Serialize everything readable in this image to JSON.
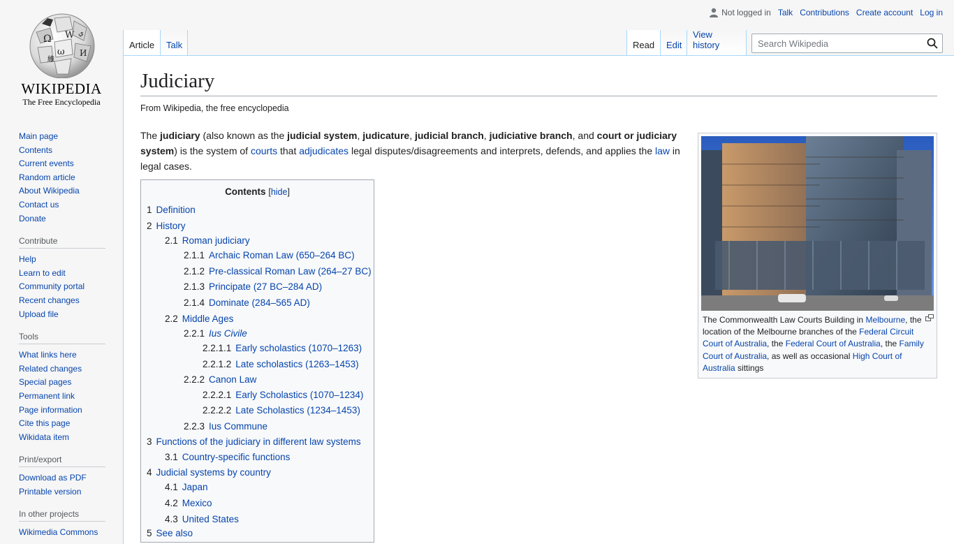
{
  "logo": {
    "wordmark": "WIKIPEDIA",
    "tagline": "The Free Encyclopedia"
  },
  "personal": {
    "not_logged_in": "Not logged in",
    "links": [
      "Talk",
      "Contributions",
      "Create account",
      "Log in"
    ]
  },
  "tabs": {
    "left": [
      "Article",
      "Talk"
    ],
    "right": [
      "Read",
      "Edit",
      "View history"
    ]
  },
  "search": {
    "placeholder": "Search Wikipedia"
  },
  "sidebar": {
    "main": [
      "Main page",
      "Contents",
      "Current events",
      "Random article",
      "About Wikipedia",
      "Contact us",
      "Donate"
    ],
    "contribute": {
      "heading": "Contribute",
      "items": [
        "Help",
        "Learn to edit",
        "Community portal",
        "Recent changes",
        "Upload file"
      ]
    },
    "tools": {
      "heading": "Tools",
      "items": [
        "What links here",
        "Related changes",
        "Special pages",
        "Permanent link",
        "Page information",
        "Cite this page",
        "Wikidata item"
      ]
    },
    "print": {
      "heading": "Print/export",
      "items": [
        "Download as PDF",
        "Printable version"
      ]
    },
    "projects": {
      "heading": "In other projects",
      "items": [
        "Wikimedia Commons"
      ]
    }
  },
  "article": {
    "title": "Judiciary",
    "from": "From Wikipedia, the free encyclopedia",
    "lead": {
      "t1": "The ",
      "b1": "judiciary",
      "t2": " (also known as the ",
      "b2": "judicial system",
      "t3": ", ",
      "b3": "judicature",
      "t4": ", ",
      "b4": "judicial branch",
      "t5": ", ",
      "b5": "judiciative branch",
      "t6": ", and ",
      "b6": "court or judiciary system",
      "t7": ") is the system of ",
      "l1": "courts",
      "t8": " that ",
      "l2": "adjudicates",
      "t9": " legal disputes/disagreements and interprets, defends, and applies the ",
      "l3": "law",
      "t10": " in legal cases."
    }
  },
  "toc": {
    "title": "Contents",
    "hide": "hide",
    "items": [
      {
        "num": "1",
        "label": "Definition",
        "level": 1
      },
      {
        "num": "2",
        "label": "History",
        "level": 1
      },
      {
        "num": "2.1",
        "label": "Roman judiciary",
        "level": 2
      },
      {
        "num": "2.1.1",
        "label": "Archaic Roman Law (650–264 BC)",
        "level": 3
      },
      {
        "num": "2.1.2",
        "label": "Pre-classical Roman Law (264–27 BC)",
        "level": 3
      },
      {
        "num": "2.1.3",
        "label": "Principate (27 BC–284 AD)",
        "level": 3
      },
      {
        "num": "2.1.4",
        "label": "Dominate (284–565 AD)",
        "level": 3
      },
      {
        "num": "2.2",
        "label": "Middle Ages",
        "level": 2
      },
      {
        "num": "2.2.1",
        "label": "Ius Civile",
        "level": 3,
        "italic": true
      },
      {
        "num": "2.2.1.1",
        "label": "Early scholastics (1070–1263)",
        "level": 4
      },
      {
        "num": "2.2.1.2",
        "label": "Late scholastics (1263–1453)",
        "level": 4
      },
      {
        "num": "2.2.2",
        "label": "Canon Law",
        "level": 3
      },
      {
        "num": "2.2.2.1",
        "label": "Early Scholastics (1070–1234)",
        "level": 4
      },
      {
        "num": "2.2.2.2",
        "label": "Late Scholastics (1234–1453)",
        "level": 4
      },
      {
        "num": "2.2.3",
        "label": "Ius Commune",
        "level": 3
      },
      {
        "num": "3",
        "label": "Functions of the judiciary in different law systems",
        "level": 1
      },
      {
        "num": "3.1",
        "label": "Country-specific functions",
        "level": 2
      },
      {
        "num": "4",
        "label": "Judicial systems by country",
        "level": 1
      },
      {
        "num": "4.1",
        "label": "Japan",
        "level": 2
      },
      {
        "num": "4.2",
        "label": "Mexico",
        "level": 2
      },
      {
        "num": "4.3",
        "label": "United States",
        "level": 2
      },
      {
        "num": "5",
        "label": "See also",
        "level": 1
      }
    ]
  },
  "thumb": {
    "c1": "The Commonwealth Law Courts Building in ",
    "l1": "Melbourne",
    "c2": ", the location of the Melbourne branches of the ",
    "l2": "Federal Circuit Court of Australia",
    "c3": ", the ",
    "l3": "Federal Court of Australia",
    "c4": ", the ",
    "l4": "Family Court of Australia",
    "c5": ", as well as occasional ",
    "l5": "High Court of Australia",
    "c6": " sittings"
  },
  "colors": {
    "link": "#0645ad",
    "tab_border": "#a7d7f9",
    "sky": "#3a6fc8"
  }
}
